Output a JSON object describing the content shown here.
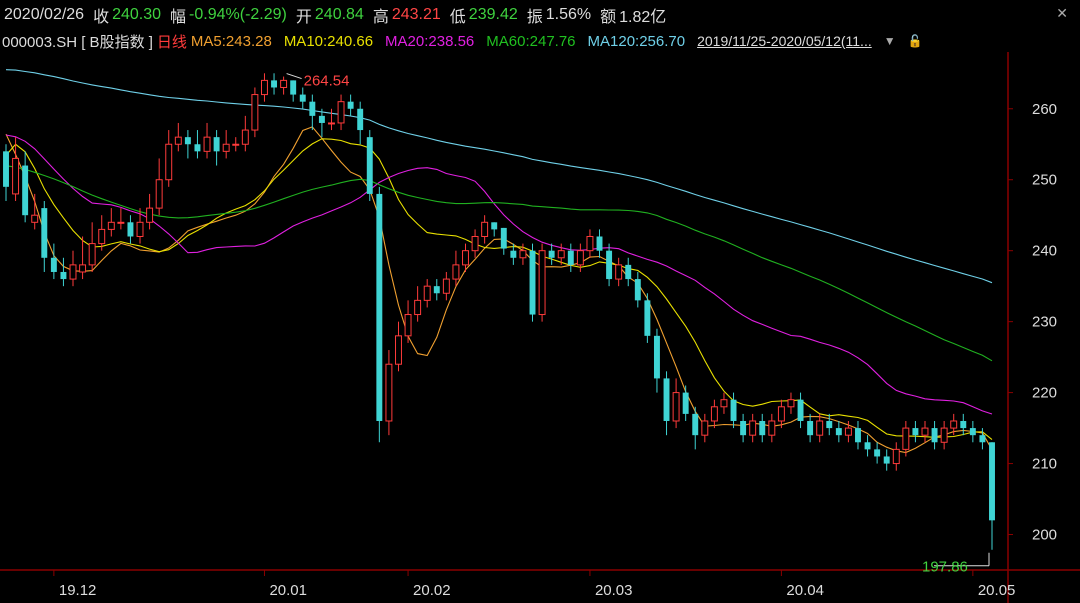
{
  "header": {
    "date": "2020/02/26",
    "close_label": "收",
    "close": "240.30",
    "change_label": "幅",
    "change": "-0.94%(-2.29)",
    "open_label": "开",
    "open": "240.84",
    "high_label": "高",
    "high": "243.21",
    "low_label": "低",
    "low": "239.42",
    "amplitude_label": "振",
    "amplitude": "1.56%",
    "amount_label": "额",
    "amount": "1.82亿",
    "close_icon": "close-icon"
  },
  "ma_bar": {
    "code": "000003.SH [ B股指数 ]",
    "period": "日线",
    "ma5": "MA5:243.28",
    "ma10": "MA10:240.66",
    "ma20": "MA20:238.56",
    "ma60": "MA60:247.76",
    "ma120": "MA120:256.70",
    "range": "2019/11/25-2020/05/12(11...",
    "dropdown_icon": "chevron-down-icon",
    "lock_icon": "lock-icon"
  },
  "colors": {
    "up": "#ff3b3b",
    "down": "#3fd4d4",
    "ma5": "#f0a030",
    "ma10": "#e8e000",
    "ma20": "#e020e0",
    "ma60": "#20b020",
    "ma120": "#6fd0e8",
    "grid": "#3a0000",
    "axis": "#8b0000"
  },
  "chart_data": {
    "type": "candlestick",
    "ylim": [
      195,
      268
    ],
    "yticks": [
      200,
      210,
      220,
      230,
      240,
      250,
      260
    ],
    "xtick_labels": [
      {
        "label": "19.12",
        "index": 5
      },
      {
        "label": "20.01",
        "index": 27
      },
      {
        "label": "20.02",
        "index": 42
      },
      {
        "label": "20.03",
        "index": 61
      },
      {
        "label": "20.04",
        "index": 81
      },
      {
        "label": "20.05",
        "index": 101
      }
    ],
    "annotations": [
      {
        "label": "264.54",
        "index": 29,
        "value": 264.54,
        "kind": "high"
      },
      {
        "label": "197.86",
        "index": 103,
        "value": 197.86,
        "kind": "low"
      }
    ],
    "candles": [
      [
        254,
        249,
        255,
        247
      ],
      [
        248,
        253,
        256,
        247
      ],
      [
        252,
        245,
        254,
        244
      ],
      [
        244,
        245,
        248,
        243
      ],
      [
        246,
        239,
        247,
        237
      ],
      [
        239,
        237,
        241,
        236
      ],
      [
        237,
        236,
        239,
        235
      ],
      [
        236,
        238,
        240,
        235
      ],
      [
        237,
        238,
        242,
        236
      ],
      [
        238,
        241,
        244,
        237
      ],
      [
        241,
        243,
        245,
        240
      ],
      [
        243,
        244,
        246,
        242
      ],
      [
        244,
        244,
        246,
        243
      ],
      [
        244,
        242,
        245,
        241
      ],
      [
        242,
        244,
        246,
        241
      ],
      [
        244,
        246,
        248,
        243
      ],
      [
        246,
        250,
        253,
        245
      ],
      [
        250,
        255,
        257,
        249
      ],
      [
        255,
        256,
        258,
        254
      ],
      [
        256,
        255,
        257,
        253
      ],
      [
        255,
        254,
        257,
        253
      ],
      [
        254,
        256,
        258,
        253
      ],
      [
        256,
        254,
        257,
        252
      ],
      [
        254,
        255,
        257,
        253
      ],
      [
        255,
        255,
        256,
        254
      ],
      [
        255,
        257,
        259,
        254
      ],
      [
        257,
        262,
        263,
        256
      ],
      [
        262,
        264,
        265,
        261
      ],
      [
        264,
        263,
        265,
        262
      ],
      [
        263,
        264,
        264.54,
        262
      ],
      [
        264,
        262,
        264,
        261
      ],
      [
        262,
        261,
        263,
        260
      ],
      [
        261,
        259,
        262,
        257
      ],
      [
        259,
        258,
        260,
        256
      ],
      [
        258,
        258,
        260,
        257
      ],
      [
        258,
        261,
        262,
        257
      ],
      [
        261,
        260,
        262,
        259
      ],
      [
        260,
        257,
        261,
        255
      ],
      [
        256,
        248,
        257,
        247
      ],
      [
        248,
        216,
        249,
        213
      ],
      [
        216,
        224,
        226,
        214
      ],
      [
        224,
        228,
        230,
        223
      ],
      [
        228,
        231,
        233,
        227
      ],
      [
        231,
        233,
        235,
        230
      ],
      [
        233,
        235,
        236,
        232
      ],
      [
        235,
        234,
        236,
        233
      ],
      [
        234,
        236,
        237,
        233
      ],
      [
        236,
        238,
        240,
        235
      ],
      [
        238,
        240,
        241,
        237
      ],
      [
        240,
        242,
        243,
        239
      ],
      [
        242,
        244,
        245,
        241
      ],
      [
        244,
        243,
        244,
        242
      ],
      [
        243.21,
        240.3,
        243.21,
        239.42
      ],
      [
        240,
        239,
        241,
        238
      ],
      [
        239,
        240,
        241,
        238
      ],
      [
        240,
        231,
        241,
        230
      ],
      [
        231,
        240,
        241,
        230
      ],
      [
        240,
        239,
        241,
        238
      ],
      [
        239,
        240,
        241,
        238
      ],
      [
        240,
        238,
        241,
        237
      ],
      [
        238,
        240,
        241,
        237
      ],
      [
        240,
        242,
        243,
        239
      ],
      [
        242,
        240,
        243,
        239
      ],
      [
        240,
        236,
        241,
        235
      ],
      [
        236,
        238,
        239,
        235
      ],
      [
        238,
        236,
        239,
        235
      ],
      [
        236,
        233,
        237,
        232
      ],
      [
        233,
        228,
        234,
        227
      ],
      [
        228,
        222,
        229,
        220
      ],
      [
        222,
        216,
        223,
        214
      ],
      [
        216,
        220,
        222,
        215
      ],
      [
        220,
        217,
        221,
        216
      ],
      [
        217,
        214,
        218,
        212
      ],
      [
        214,
        216,
        217,
        213
      ],
      [
        216,
        218,
        219,
        215
      ],
      [
        218,
        219,
        220,
        217
      ],
      [
        219,
        216,
        220,
        215
      ],
      [
        216,
        214,
        217,
        213
      ],
      [
        214,
        216,
        217,
        213
      ],
      [
        216,
        214,
        217,
        213
      ],
      [
        214,
        216,
        217,
        213
      ],
      [
        216,
        218,
        219,
        215
      ],
      [
        218,
        219,
        220,
        217
      ],
      [
        219,
        216,
        220,
        215
      ],
      [
        216,
        214,
        217,
        213
      ],
      [
        214,
        216,
        217,
        213
      ],
      [
        216,
        215,
        217,
        214
      ],
      [
        215,
        214,
        216,
        213
      ],
      [
        214,
        215,
        216,
        213
      ],
      [
        215,
        213,
        216,
        212
      ],
      [
        213,
        212,
        214,
        211
      ],
      [
        212,
        211,
        213,
        210
      ],
      [
        211,
        210,
        212,
        209
      ],
      [
        210,
        212,
        213,
        209
      ],
      [
        212,
        215,
        216,
        211
      ],
      [
        215,
        214,
        216,
        213
      ],
      [
        214,
        215,
        216,
        213
      ],
      [
        215,
        213,
        216,
        212
      ],
      [
        213,
        215,
        216,
        212
      ],
      [
        215,
        216,
        217,
        214
      ],
      [
        216,
        215,
        217,
        214
      ],
      [
        215,
        214,
        216,
        213
      ],
      [
        214,
        213,
        215,
        212
      ],
      [
        213,
        202,
        213,
        197.86
      ]
    ],
    "series": [
      {
        "name": "MA5",
        "values": [
          256.43,
          253.55,
          250.46,
          246.93,
          242.58,
          239.3,
          237.78,
          237.16,
          237.09,
          237.19,
          238.61,
          239.97,
          241.03,
          240.68,
          240.1,
          239.97,
          239.8,
          240.38,
          241.47,
          242.8,
          243.3,
          243.74,
          244.15,
          244.6,
          245.0,
          245.57,
          246.61,
          248.25,
          250.47,
          252.18,
          254.43,
          256.94,
          257.44,
          255.84,
          254.12,
          252.49,
          251.08,
          250.45,
          248.6,
          244.71,
          238.0,
          232.33,
          227.93,
          225.5,
          225.23,
          227.8,
          231.66,
          234.94,
          237.31,
          238.78,
          240.33,
          241.59,
          241.66,
          240.89,
          240.03,
          238.62,
          237.71,
          237.74,
          237.69,
          237.96,
          238.3,
          239.09,
          239.18,
          238.49,
          237.84,
          236.3,
          235.42,
          233.25,
          230.3,
          227.0,
          223.65,
          220.11,
          217.36,
          215.26,
          215.36,
          215.51,
          215.46,
          215.37,
          215.69,
          215.54,
          215.25,
          215.46,
          215.85,
          216.54,
          216.64,
          216.61,
          216.34,
          215.91,
          215.43,
          214.89,
          214.23,
          212.99,
          212.31,
          211.8,
          211.56,
          212.17,
          212.94,
          213.76,
          214.04,
          214.5,
          214.67,
          214.52,
          214.32,
          211.95
        ]
      },
      {
        "name": "MA10",
        "values": [
          253.43,
          254.99,
          253.94,
          251.58,
          248.72,
          246.48,
          244.63,
          242.84,
          241.44,
          240.52,
          240.6,
          240.95,
          241.26,
          240.94,
          240.67,
          240.23,
          239.85,
          240.14,
          241.01,
          242.14,
          242.84,
          243.63,
          244.58,
          245.31,
          245.86,
          246.36,
          247.18,
          248.44,
          250.07,
          251.35,
          252.71,
          254.06,
          255.05,
          255.77,
          255.71,
          255.53,
          255.08,
          254.91,
          254.46,
          252.91,
          250.25,
          247.21,
          245.1,
          243.76,
          242.55,
          242.34,
          242.21,
          242.08,
          241.59,
          240.93,
          240.45,
          240.32,
          240.45,
          240.58,
          240.49,
          239.94,
          239.21,
          238.81,
          238.37,
          237.92,
          237.66,
          237.9,
          238.42,
          238.22,
          237.95,
          237.47,
          237.22,
          236.25,
          234.93,
          233.19,
          231.26,
          229.35,
          227.12,
          224.51,
          222.08,
          220.2,
          218.84,
          218.32,
          218.09,
          218.36,
          218.75,
          218.82,
          218.86,
          218.96,
          217.95,
          217.01,
          216.73,
          216.88,
          216.68,
          216.49,
          216.08,
          215.11,
          214.16,
          213.91,
          213.87,
          213.85,
          213.78,
          213.7,
          213.76,
          213.81,
          214.09,
          214.43,
          214.47,
          213.37
        ]
      },
      {
        "name": "MA20",
        "values": [
          256.3,
          256.05,
          255.41,
          254.36,
          252.94,
          251.5,
          250.1,
          248.78,
          247.63,
          246.7,
          246.58,
          246.47,
          246.1,
          245.6,
          245.2,
          244.5,
          243.48,
          242.36,
          241.08,
          239.72,
          239.77,
          240.14,
          240.43,
          240.52,
          240.6,
          240.68,
          240.66,
          241.06,
          241.8,
          242.65,
          243.48,
          244.06,
          244.59,
          245.04,
          245.61,
          246.16,
          246.75,
          247.52,
          248.58,
          249.63,
          250.32,
          250.88,
          251.3,
          251.61,
          251.69,
          251.46,
          250.88,
          250.58,
          250.32,
          249.78,
          248.35,
          246.61,
          245.05,
          243.76,
          242.68,
          241.86,
          241.2,
          240.76,
          240.42,
          240.13,
          240.06,
          240.15,
          240.35,
          240.42,
          240.28,
          239.69,
          239.24,
          238.77,
          238.38,
          237.84,
          237.14,
          236.49,
          235.82,
          234.82,
          233.91,
          232.84,
          231.76,
          230.9,
          230.13,
          229.61,
          229.07,
          228.56,
          228.05,
          227.94,
          227.52,
          227.08,
          226.71,
          226.25,
          225.69,
          224.9,
          223.95,
          222.65,
          221.3,
          220.31,
          219.83,
          219.51,
          219.12,
          218.98,
          218.91,
          218.81,
          218.58,
          218.02,
          217.42,
          216.99
        ]
      },
      {
        "name": "MA60",
        "values": [
          251.98,
          251.76,
          251.45,
          251.04,
          250.59,
          250.12,
          249.59,
          249.03,
          248.41,
          247.83,
          247.33,
          246.84,
          246.38,
          245.93,
          245.49,
          245.15,
          244.88,
          244.7,
          244.62,
          244.65,
          244.78,
          244.95,
          245.11,
          245.27,
          245.43,
          245.63,
          245.97,
          246.39,
          246.84,
          247.32,
          247.79,
          248.26,
          248.64,
          248.96,
          249.24,
          249.58,
          249.87,
          250.06,
          249.89,
          249.28,
          248.72,
          248.23,
          247.81,
          247.49,
          247.21,
          246.94,
          246.76,
          246.64,
          246.63,
          246.69,
          246.76,
          246.77,
          246.71,
          246.61,
          246.52,
          246.28,
          246.2,
          246.1,
          246.0,
          245.86,
          245.76,
          245.76,
          245.76,
          245.74,
          245.72,
          245.67,
          245.54,
          245.33,
          244.96,
          244.42,
          243.97,
          243.47,
          242.89,
          242.37,
          241.91,
          241.39,
          240.82,
          240.21,
          239.62,
          239.01,
          238.5,
          238.0,
          237.52,
          236.96,
          236.41,
          235.87,
          235.26,
          234.65,
          234.0,
          233.32,
          232.64,
          231.96,
          231.27,
          230.61,
          229.98,
          229.38,
          228.74,
          228.09,
          227.46,
          226.92,
          226.36,
          225.79,
          225.25,
          224.48
        ]
      },
      {
        "name": "MA120",
        "values": [
          265.5,
          265.45,
          265.25,
          265.07,
          264.79,
          264.53,
          264.24,
          263.92,
          263.63,
          263.37,
          263.12,
          262.91,
          262.66,
          262.41,
          262.2,
          261.97,
          261.75,
          261.59,
          261.47,
          261.33,
          261.2,
          261.09,
          260.95,
          260.83,
          260.71,
          260.61,
          260.51,
          260.45,
          260.36,
          260.25,
          260.11,
          259.95,
          259.76,
          259.56,
          259.36,
          259.18,
          258.98,
          258.74,
          258.4,
          257.79,
          257.31,
          256.89,
          256.52,
          256.21,
          255.89,
          255.56,
          255.26,
          254.99,
          254.73,
          254.51,
          254.3,
          254.05,
          253.79,
          253.51,
          253.24,
          252.87,
          252.62,
          252.39,
          252.17,
          251.92,
          251.71,
          251.52,
          251.33,
          251.09,
          250.86,
          250.6,
          250.32,
          250.0,
          249.62,
          249.18,
          248.78,
          248.37,
          247.92,
          247.5,
          247.11,
          246.73,
          246.32,
          245.92,
          245.54,
          245.16,
          244.79,
          244.41,
          244.06,
          243.68,
          243.3,
          242.9,
          242.51,
          242.09,
          241.66,
          241.23,
          240.8,
          240.36,
          239.92,
          239.5,
          239.08,
          238.69,
          238.31,
          237.91,
          237.53,
          237.15,
          236.76,
          236.38,
          236.01,
          235.49
        ]
      }
    ]
  }
}
